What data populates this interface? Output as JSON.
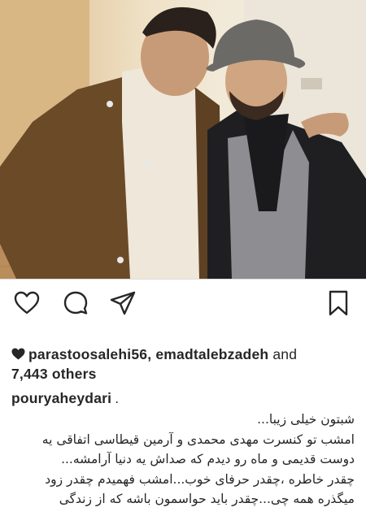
{
  "post": {
    "likes_line1": {
      "user1": "parastoosalehi56",
      "sep": ", ",
      "user2": "emadtalebzadeh",
      "and": " and"
    },
    "likes_line2": "7,443 others",
    "author": "pouryaheydari",
    "author_suffix": ".",
    "caption_lines": [
      "شبتون خیلی زیبا...",
      "امشب تو کنسرت مهدی محمدی و آرمین قیطاسی اتفاقی یه",
      "دوست قدیمی و ماه رو دیدم که صداش یه دنیا آرامشه...",
      "چقدر خاطره ،چقدر حرفای خوب...امشب فهمیدم چقدر زود",
      "میگذره همه چی...چقدر باید حواسمون باشه که از زندگی"
    ]
  },
  "icons": {
    "like": "heart-outline-icon",
    "comment": "comment-bubble-icon",
    "share": "paper-plane-icon",
    "save": "bookmark-icon",
    "liked_by": "heart-filled-icon"
  },
  "colors": {
    "text": "#262626",
    "divider": "#dbdbdb",
    "background": "#ffffff"
  }
}
